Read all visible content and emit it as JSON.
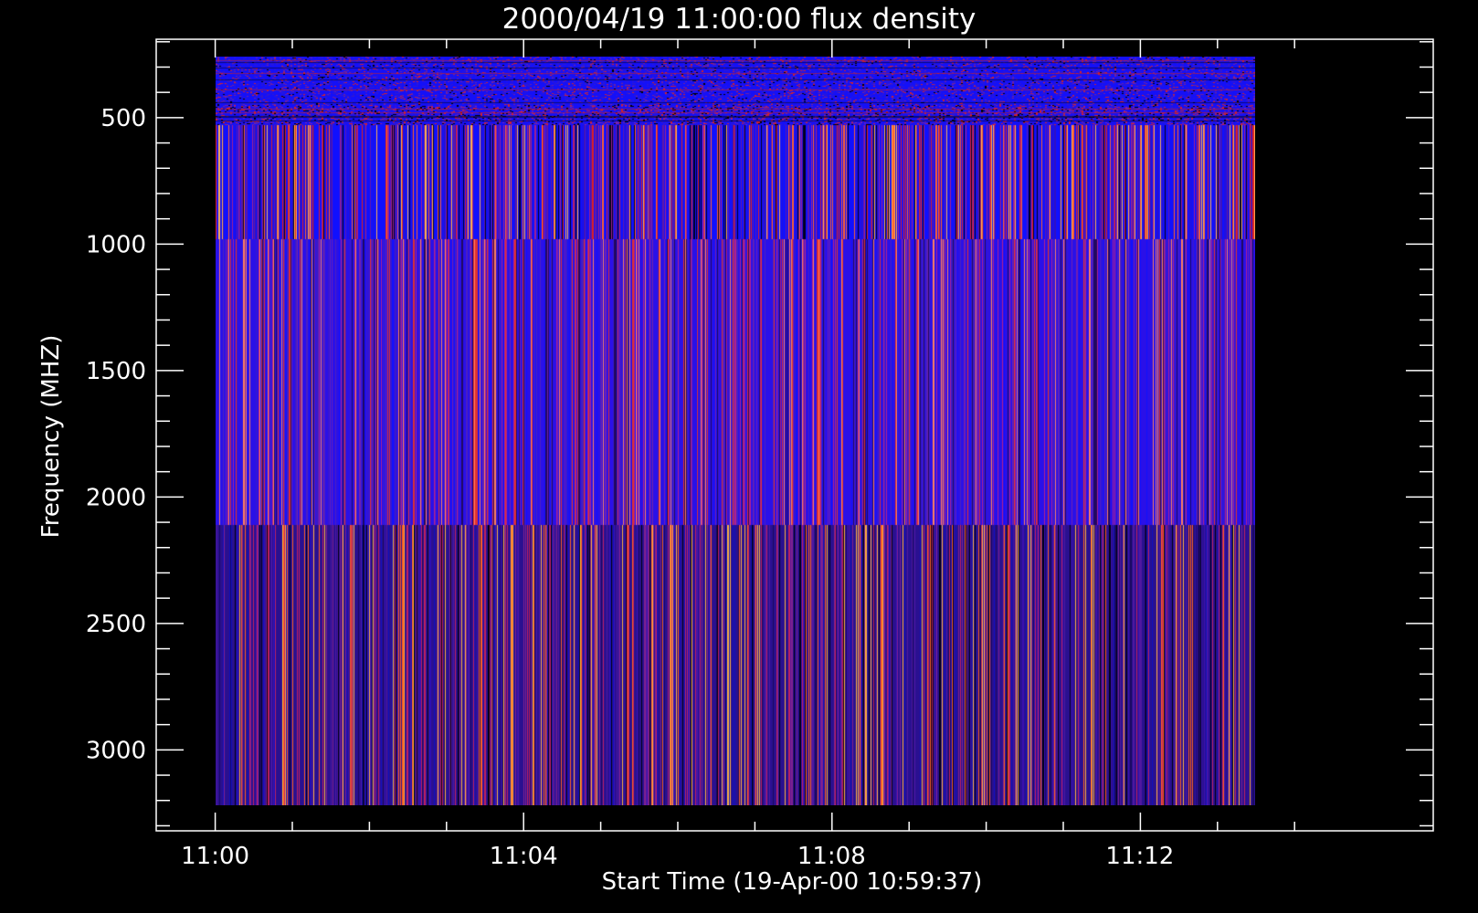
{
  "chart_data": {
    "type": "heatmap",
    "title": "2000/04/19 11:00:00 flux density",
    "xlabel": "Start Time (19-Apr-00 10:59:37)",
    "ylabel": "Frequency (MHZ)",
    "x_range_minutes": [
      11.0,
      11.25
    ],
    "x_data_extent_minutes": [
      11.0,
      11.225
    ],
    "ylim": [
      3320,
      190
    ],
    "y_reversed": true,
    "x_major_ticks": [
      {
        "value": 11.0,
        "label": "11:00"
      },
      {
        "value": 11.0667,
        "label": "11:04"
      },
      {
        "value": 11.1333,
        "label": "11:08"
      },
      {
        "value": 11.2,
        "label": "11:12"
      }
    ],
    "y_major_ticks": [
      {
        "value": 500,
        "label": "500"
      },
      {
        "value": 1000,
        "label": "1000"
      },
      {
        "value": 1500,
        "label": "1500"
      },
      {
        "value": 2000,
        "label": "2000"
      },
      {
        "value": 2500,
        "label": "2500"
      },
      {
        "value": 3000,
        "label": "3000"
      }
    ],
    "frequency_bands_mhz": [
      {
        "from": 260,
        "to": 530,
        "texture": "noisy-horizontal",
        "dominant": "#1a10f0"
      },
      {
        "from": 530,
        "to": 980,
        "texture": "vertical-stripes",
        "dominant": "#2010e0"
      },
      {
        "from": 980,
        "to": 2110,
        "texture": "vertical-stripes",
        "dominant": "#3a1ac8"
      },
      {
        "from": 2110,
        "to": 3220,
        "texture": "vertical-stripes",
        "dominant": "#2a1090"
      }
    ],
    "colormap": [
      "#000000",
      "#1010ff",
      "#4010c0",
      "#9020a0",
      "#e02020",
      "#ff8030",
      "#ffd060"
    ],
    "colors": {
      "background": "#000000",
      "axes": "#ffffff",
      "text": "#ffffff"
    }
  }
}
